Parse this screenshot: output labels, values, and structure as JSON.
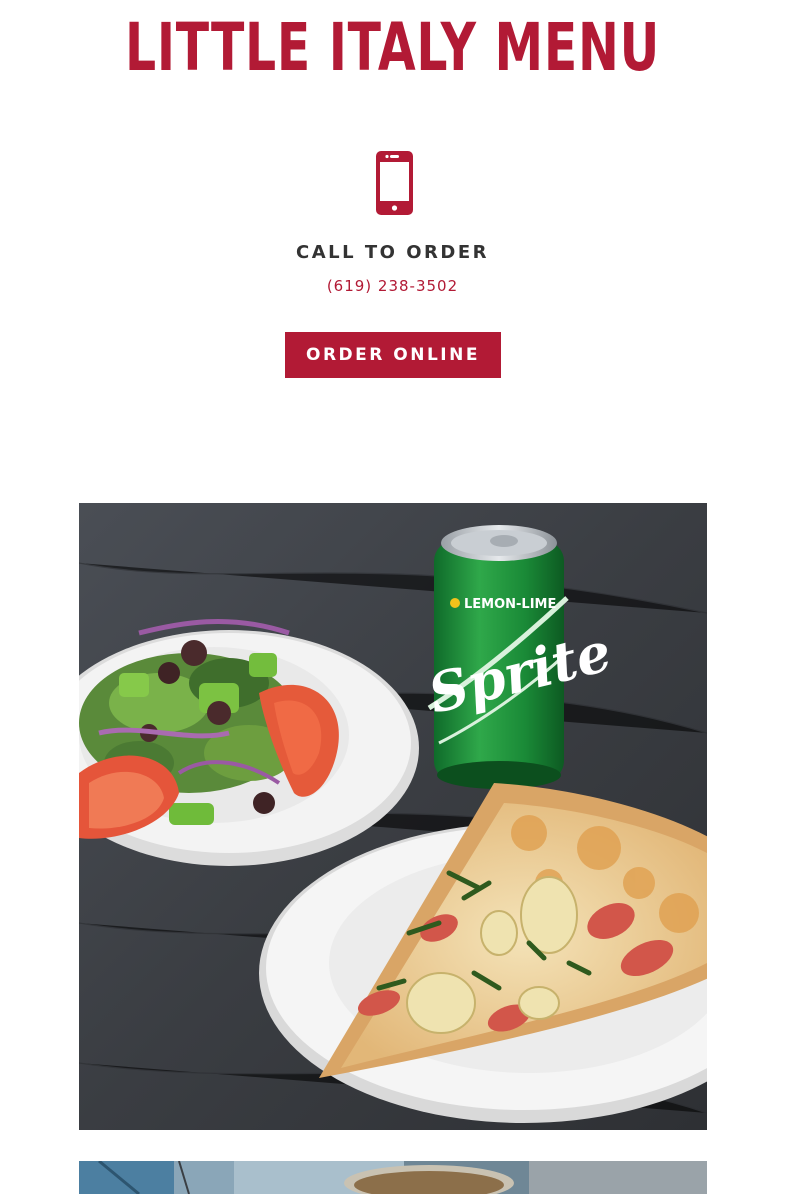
{
  "header": {
    "title": "LITTLE ITALY MENU"
  },
  "contact": {
    "icon": "mobile-phone-icon",
    "heading": "CALL TO ORDER",
    "phone": "(619) 238-3502"
  },
  "actions": {
    "order_online_label": "ORDER ONLINE"
  },
  "gallery": {
    "images": [
      {
        "name": "salad-soda-pizza-photo",
        "can_brand": "Sprite",
        "can_subtitle": "LEMON-LIME"
      },
      {
        "name": "second-food-photo"
      }
    ]
  },
  "colors": {
    "brand_red": "#b21a35",
    "heading_text": "#333333",
    "background": "#ffffff"
  }
}
